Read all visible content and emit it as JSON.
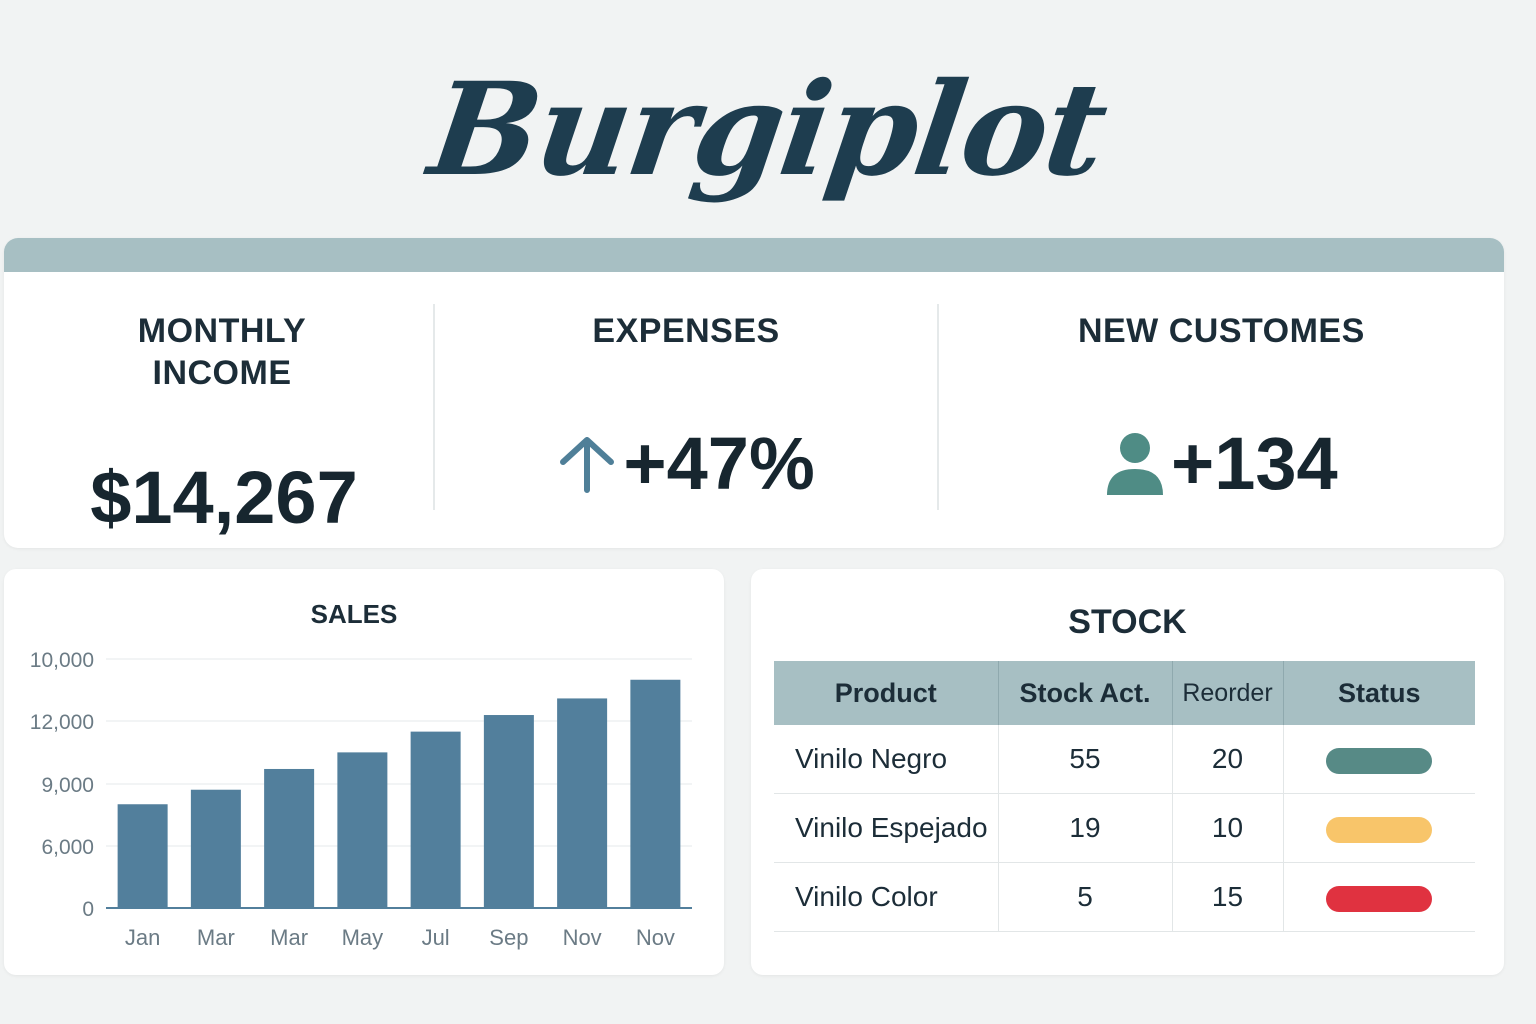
{
  "brand": {
    "logo_text": "Burgiplot",
    "color": "#1e3d4f"
  },
  "kpis": {
    "income": {
      "label_line1": "MONTHLY",
      "label_line2": "INCOME",
      "value": "$14,267"
    },
    "expenses": {
      "label": "EXPENSES",
      "value": "+47%",
      "icon": "arrow-up-icon",
      "icon_color": "#4f7f98"
    },
    "customers": {
      "label": "NEW CUSTOMES",
      "value": "+134",
      "icon": "user-icon",
      "icon_color": "#4f8c85"
    },
    "header_color": "#a7bfc3"
  },
  "sales": {
    "title": "SALES",
    "chart_data": {
      "type": "bar",
      "title": "SALES",
      "categories": [
        "Jan",
        "Mar",
        "Mar",
        "May",
        "Jul",
        "Sep",
        "Nov",
        "Nov"
      ],
      "values": [
        5000,
        5700,
        6700,
        7500,
        8500,
        9300,
        10100,
        11000
      ],
      "y_tick_labels": [
        "0",
        "6,000",
        "9,000",
        "12,000",
        "10,000"
      ],
      "bar_color": "#527f9c",
      "grid": true
    }
  },
  "stock": {
    "title": "STOCK",
    "columns": [
      "Product",
      "Stock Act.",
      "Reorder",
      "Status"
    ],
    "rows": [
      {
        "product": "Vinilo Negro",
        "stock": "55",
        "reorder": "20",
        "status_color": "#578a86"
      },
      {
        "product": "Vinilo Espejado",
        "stock": "19",
        "reorder": "10",
        "status_color": "#f8c56a"
      },
      {
        "product": "Vinilo Color",
        "stock": "5",
        "reorder": "15",
        "status_color": "#e03240"
      }
    ]
  }
}
